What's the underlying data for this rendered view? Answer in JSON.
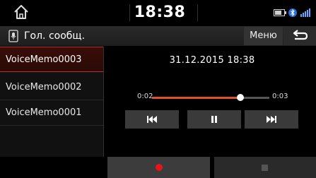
{
  "status_bar": {
    "clock": "18:38",
    "icons": [
      "battery-icon",
      "bluetooth-icon",
      "signal-icon"
    ]
  },
  "title_bar": {
    "title": "Гол. сообщ.",
    "title_icon": "voice-memo-icon",
    "menu_label": "Меню",
    "back_icon": "back-arrow-icon"
  },
  "memo_list": {
    "items": [
      {
        "label": "VoiceMemo0003",
        "selected": true
      },
      {
        "label": "VoiceMemo0002",
        "selected": false
      },
      {
        "label": "VoiceMemo0001",
        "selected": false
      }
    ]
  },
  "player": {
    "datetime": "31.12.2015 18:38",
    "current_time": "0:02",
    "total_time": "0:03",
    "progress": 0.75,
    "controls": {
      "previous": "previous-track-icon",
      "pause": "pause-icon",
      "next": "next-track-icon"
    }
  },
  "recorder": {
    "record_icon": "record-icon",
    "stop_icon": "stop-icon"
  },
  "colors": {
    "accent": "#e0502a",
    "record": "#e8141a",
    "background": "#000000"
  }
}
